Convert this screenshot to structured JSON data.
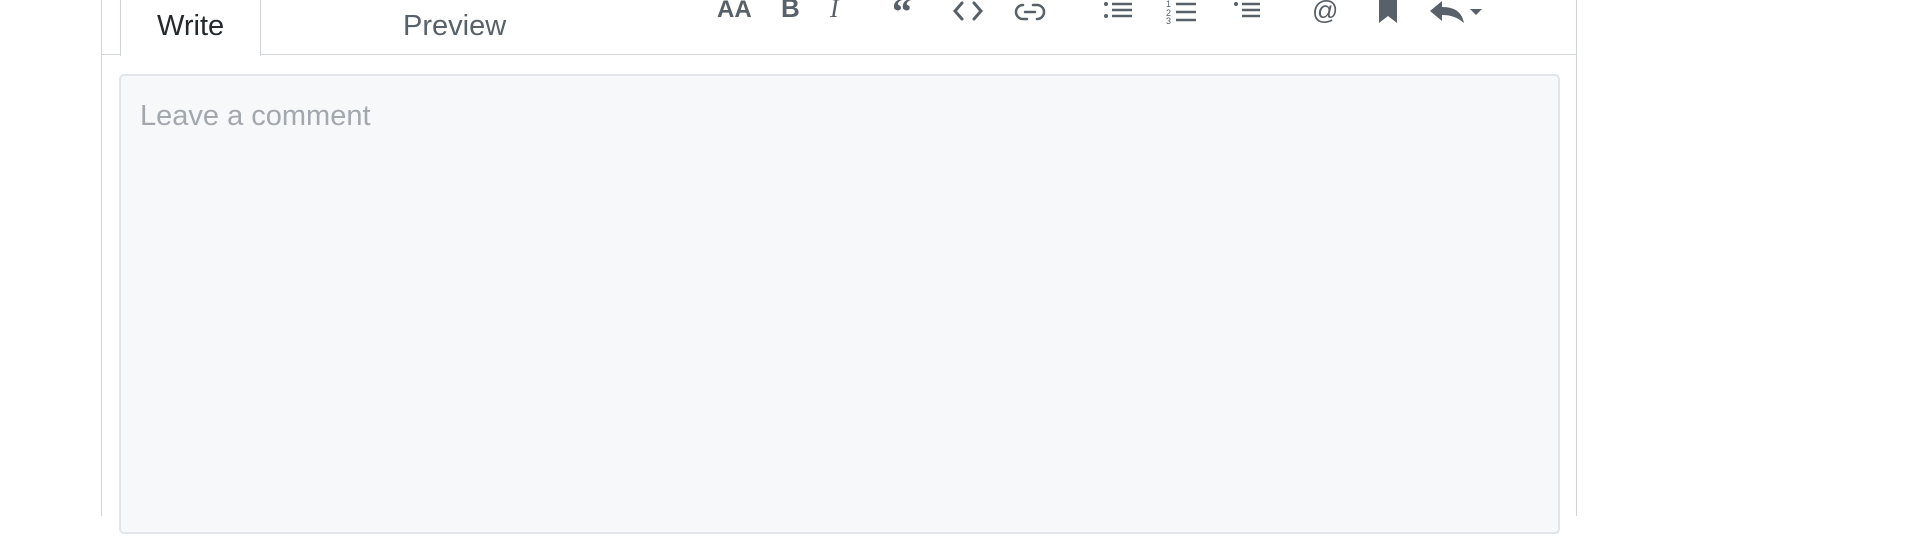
{
  "tabs": {
    "write": "Write",
    "preview": "Preview"
  },
  "comment": {
    "placeholder": "Leave a comment",
    "value": ""
  },
  "toolbar": {
    "icons": [
      "text-size-icon",
      "bold-icon",
      "italic-icon",
      "quote-icon",
      "code-icon",
      "link-icon",
      "unordered-list-icon",
      "ordered-list-icon",
      "task-list-icon",
      "mention-icon",
      "bookmark-icon",
      "reply-icon"
    ]
  },
  "colors": {
    "tab_text": "#586069",
    "tab_active_text": "#24292e",
    "border": "#d1d5da",
    "textarea_bg": "#f6f8fa",
    "placeholder": "#a3a8ae"
  }
}
